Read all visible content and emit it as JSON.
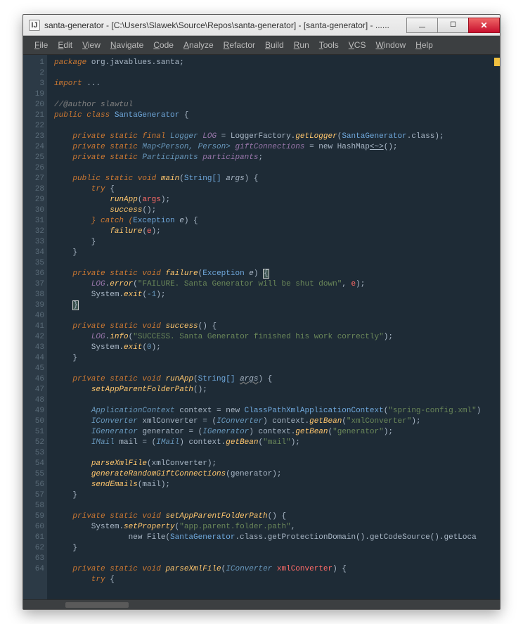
{
  "titlebar": {
    "icon_text": "IJ",
    "text": "santa-generator - [C:\\Users\\Slawek\\Source\\Repos\\santa-generator] - [santa-generator] - ......"
  },
  "menu": {
    "items": [
      "File",
      "Edit",
      "View",
      "Navigate",
      "Code",
      "Analyze",
      "Refactor",
      "Build",
      "Run",
      "Tools",
      "VCS",
      "Window",
      "Help"
    ]
  },
  "gutter": {
    "lines": [
      "1",
      "2",
      "3",
      "",
      "19",
      "20",
      "21",
      "22",
      "23",
      "24",
      "25",
      "26",
      "27",
      "28",
      "29",
      "30",
      "31",
      "32",
      "33",
      "34",
      "35",
      "36",
      "37",
      "38",
      "39",
      "40",
      "41",
      "42",
      "43",
      "44",
      "45",
      "46",
      "47",
      "48",
      "49",
      "50",
      "51",
      "52",
      "53",
      "54",
      "55",
      "56",
      "57",
      "58",
      "59",
      "60",
      "61",
      "62",
      "63",
      "64"
    ]
  },
  "code": {
    "l1_a": "package ",
    "l1_b": "org.javablues.santa;",
    "l3_a": "import ",
    "l3_b": "...",
    "l5": "//@author slawtul",
    "l6_a": "public class ",
    "l6_b": "SantaGenerator ",
    "l6_c": "{",
    "l8_a": "    private static final ",
    "l8_b": "Logger ",
    "l8_c": "LOG ",
    "l8_d": "= LoggerFactory.",
    "l8_e": "getLogger",
    "l8_f": "(",
    "l8_g": "SantaGenerator",
    "l8_h": ".class);",
    "l9_a": "    private static ",
    "l9_b": "Map",
    "l9_c": "<Person, Person> ",
    "l9_d": "giftConnections ",
    "l9_e": "= new HashMap",
    "l9_f": "<~>",
    "l9_g": "();",
    "l10_a": "    private static ",
    "l10_b": "Participants ",
    "l10_c": "participants",
    "l10_d": ";",
    "l12_a": "    public static void ",
    "l12_b": "main",
    "l12_c": "(",
    "l12_d": "String[] ",
    "l12_e": "args",
    "l12_f": ") {",
    "l13_a": "        try ",
    "l13_b": "{",
    "l14_a": "            ",
    "l14_b": "runApp",
    "l14_c": "(",
    "l14_d": "args",
    "l14_e": ");",
    "l15_a": "            ",
    "l15_b": "success",
    "l15_c": "();",
    "l16_a": "        } catch (",
    "l16_b": "Exception ",
    "l16_c": "e",
    "l16_d": ") {",
    "l17_a": "            ",
    "l17_b": "failure",
    "l17_c": "(",
    "l17_d": "e",
    "l17_e": ");",
    "l18": "        }",
    "l19": "    }",
    "l21_a": "    private static void ",
    "l21_b": "failure",
    "l21_c": "(",
    "l21_d": "Exception ",
    "l21_e": "e",
    "l21_f": ") ",
    "l21_g": "{",
    "l22_a": "        ",
    "l22_b": "LOG",
    "l22_c": ".",
    "l22_d": "error",
    "l22_e": "(",
    "l22_f": "\"FAILURE. Santa Generator will be shut down\"",
    "l22_g": ", ",
    "l22_h": "e",
    "l22_i": ");",
    "l23_a": "        System.",
    "l23_b": "exit",
    "l23_c": "(",
    "l23_d": "-1",
    "l23_e": ");",
    "l24": "    ",
    "l24b": "}",
    "l26_a": "    private static void ",
    "l26_b": "success",
    "l26_c": "() {",
    "l27_a": "        ",
    "l27_b": "LOG",
    "l27_c": ".",
    "l27_d": "info",
    "l27_e": "(",
    "l27_f": "\"SUCCESS. Santa Generator finished his work correctly\"",
    "l27_g": ");",
    "l28_a": "        System.",
    "l28_b": "exit",
    "l28_c": "(",
    "l28_d": "0",
    "l28_e": ");",
    "l29": "    }",
    "l31_a": "    private static void ",
    "l31_b": "runApp",
    "l31_c": "(",
    "l31_d": "String[] ",
    "l31_e": "args",
    "l31_f": ") {",
    "l32_a": "        ",
    "l32_b": "setAppParentFolderPath",
    "l32_c": "();",
    "l34_a": "        ",
    "l34_b": "ApplicationContext ",
    "l34_c": "context = new ",
    "l34_d": "ClassPathXmlApplicationContext",
    "l34_e": "(",
    "l34_f": "\"spring-config.xml\"",
    "l34_g": ")",
    "l35_a": "        ",
    "l35_b": "IConverter ",
    "l35_c": "xmlConverter = (",
    "l35_d": "IConverter",
    "l35_e": ") context.",
    "l35_f": "getBean",
    "l35_g": "(",
    "l35_h": "\"xmlConverter\"",
    "l35_i": ");",
    "l36_a": "        ",
    "l36_b": "IGenerator ",
    "l36_c": "generator = (",
    "l36_d": "IGenerator",
    "l36_e": ") context.",
    "l36_f": "getBean",
    "l36_g": "(",
    "l36_h": "\"generator\"",
    "l36_i": ");",
    "l37_a": "        ",
    "l37_b": "IMail ",
    "l37_c": "mail = (",
    "l37_d": "IMail",
    "l37_e": ") context.",
    "l37_f": "getBean",
    "l37_g": "(",
    "l37_h": "\"mail\"",
    "l37_i": ");",
    "l39_a": "        ",
    "l39_b": "parseXmlFile",
    "l39_c": "(xmlConverter);",
    "l40_a": "        ",
    "l40_b": "generateRandomGiftConnections",
    "l40_c": "(generator);",
    "l41_a": "        ",
    "l41_b": "sendEmails",
    "l41_c": "(mail);",
    "l42": "    }",
    "l44_a": "    private static void ",
    "l44_b": "setAppParentFolderPath",
    "l44_c": "() {",
    "l45_a": "        System.",
    "l45_b": "setProperty",
    "l45_c": "(",
    "l45_d": "\"app.parent.folder.path\"",
    "l45_e": ",",
    "l46_a": "                new File(",
    "l46_b": "SantaGenerator",
    "l46_c": ".class.getProtectionDomain().getCodeSource().getLoca",
    "l47": "    }",
    "l49_a": "    private static void ",
    "l49_b": "parseXmlFile",
    "l49_c": "(",
    "l49_d": "IConverter ",
    "l49_e": "xmlConverter",
    "l49_f": ") {",
    "l50_a": "        try ",
    "l50_b": "{"
  }
}
